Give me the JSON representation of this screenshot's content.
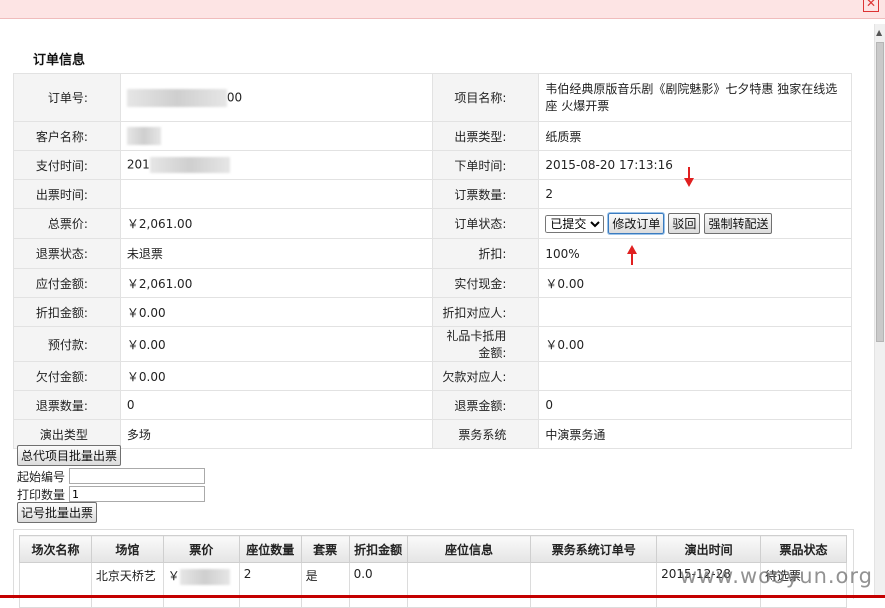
{
  "window": {
    "close_icon": "close-icon"
  },
  "section_title": "订单信息",
  "order_rows": [
    {
      "l1": "订单号:",
      "v1": "00",
      "l2": "项目名称:",
      "v2": "韦伯经典原版音乐剧《剧院魅影》七夕特惠 独家在线选座 火爆开票"
    },
    {
      "l1": "客户名称:",
      "v1": "",
      "l2": "出票类型:",
      "v2": "纸质票"
    },
    {
      "l1": "支付时间:",
      "v1": "201",
      "l2": "下单时间:",
      "v2": "2015-08-20 17:13:16"
    },
    {
      "l1": "出票时间:",
      "v1": "",
      "l2": "订票数量:",
      "v2": "2"
    },
    {
      "l1": "总票价:",
      "v1": "￥2,061.00",
      "l2": "订单状态:",
      "v2": ""
    },
    {
      "l1": "退票状态:",
      "v1": "未退票",
      "l2": "折扣:",
      "v2": "100%"
    },
    {
      "l1": "应付金额:",
      "v1": "￥2,061.00",
      "l2": "实付现金:",
      "v2": "￥0.00"
    },
    {
      "l1": "折扣金额:",
      "v1": "￥0.00",
      "l2": "折扣对应人:",
      "v2": ""
    },
    {
      "l1": "预付款:",
      "v1": "￥0.00",
      "l2": "礼品卡抵用金额:",
      "v2": "￥0.00"
    },
    {
      "l1": "欠付金额:",
      "v1": "￥0.00",
      "l2": "欠款对应人:",
      "v2": ""
    },
    {
      "l1": "退票数量:",
      "v1": "0",
      "l2": "退票金额:",
      "v2": "0"
    },
    {
      "l1": "演出类型",
      "v1": "多场",
      "l2": "票务系统",
      "v2": "中演票务通"
    }
  ],
  "status": {
    "selected": "已提交",
    "modify_button": "修改订单",
    "reject_button": "驳回",
    "force_delivery_button": "强制转配送"
  },
  "batch": {
    "batch_button": "总代项目批量出票",
    "start_label": "起始编号",
    "start_value": "",
    "print_label": "打印数量",
    "print_value": "1",
    "seat_batch_button": "记号批量出票"
  },
  "tickets": {
    "headers": [
      "场次名称",
      "场馆",
      "票价",
      "座位数量",
      "套票",
      "折扣金额",
      "座位信息",
      "票务系统订单号",
      "演出时间",
      "票品状态"
    ],
    "rows": [
      {
        "venue": "北京天桥艺",
        "price": "￥",
        "seats": "2",
        "package": "是",
        "discount": "0.0",
        "show_time": "2015-12-28",
        "status": "待选票"
      }
    ]
  },
  "watermark": "www.wooyun.org",
  "colors": {
    "accent_arrow": "#e02020",
    "label_bg": "#f4f4f4",
    "border": "#e2e2e2",
    "bottom_line": "#c40000"
  }
}
